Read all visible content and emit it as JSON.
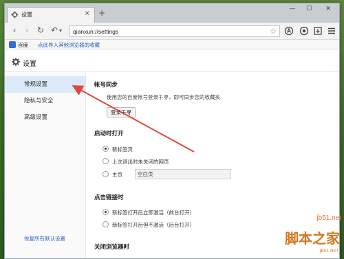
{
  "tab": {
    "title": "设置",
    "close": "×",
    "new": "+"
  },
  "window_controls": {
    "minimize": "—",
    "maximize": "☐",
    "close": "✕"
  },
  "toolbar": {
    "back": "‹",
    "forward": "›",
    "reload": "↻",
    "undo": "↶",
    "undo_menu": "▾",
    "address": "qianxun://settings",
    "star": "☆",
    "tools": [
      "adblock-icon",
      "sync-icon",
      "download-icon",
      "menu-icon"
    ]
  },
  "bookmarks": {
    "items": [
      {
        "label": "百度"
      },
      {
        "label": "点此导入其他浏览器的收藏",
        "is_link": true
      }
    ]
  },
  "settings": {
    "title": "设置",
    "sidebar": [
      {
        "label": "常规设置",
        "active": true
      },
      {
        "label": "隐私与安全"
      },
      {
        "label": "高级设置"
      }
    ],
    "restore_defaults": "恢复所有默认设置"
  },
  "content": {
    "account_sync": {
      "title": "帐号同步",
      "desc": "使用您的百度帐号登录千寻，即可同步您的收藏夹",
      "login_button": "登录千寻"
    },
    "startup": {
      "title": "启动时打开",
      "options": [
        {
          "label": "新标签页",
          "checked": true
        },
        {
          "label": "上次退出时未关闭的网页",
          "checked": false
        },
        {
          "label": "主页",
          "checked": false
        }
      ],
      "homepage_value": "空白页"
    },
    "link_click": {
      "title": "点击链接时",
      "options": [
        {
          "label": "新标签打开后立即激活（前台打开）",
          "checked": true
        },
        {
          "label": "新标签打开后但不激活（后台打开）",
          "checked": false
        }
      ]
    },
    "close_browser": {
      "title": "关闭浏览器时"
    }
  },
  "watermark": {
    "line1": "jb51.net",
    "line2": "脚本之家",
    "line3": "JB51.NET"
  },
  "colors": {
    "accent": "#2a64c5",
    "active_sidebar": "#dce9f8",
    "arrow": "#e0463d"
  }
}
